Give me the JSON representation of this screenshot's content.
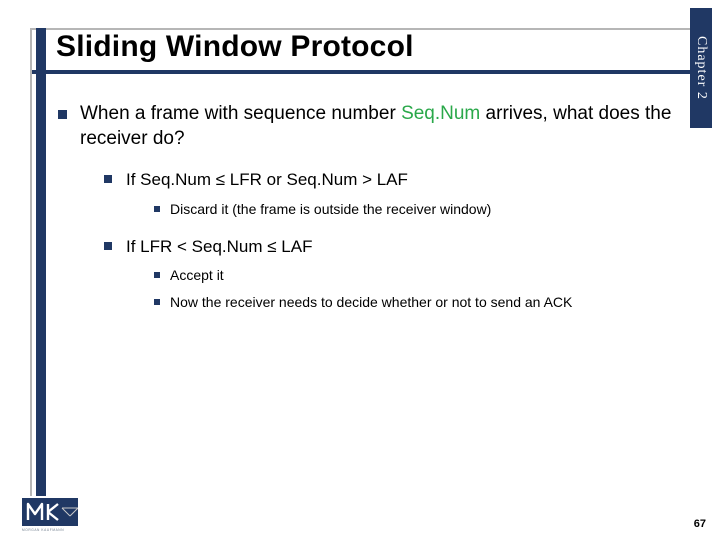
{
  "chapter_label": "Chapter 2",
  "title": "Sliding Window Protocol",
  "body": {
    "lead_pre": "When a frame with sequence number ",
    "seqnum": "Seq.Num",
    "lead_post": " arrives, what does the receiver do?",
    "cond1": "If Seq.Num ≤ LFR or Seq.Num > LAF",
    "cond1_sub": "Discard it (the frame is outside the receiver window)",
    "cond2": "If LFR < Seq.Num ≤ LAF",
    "cond2_sub1": "Accept it",
    "cond2_sub2": "Now the receiver needs to decide whether or not to send an ACK"
  },
  "page_number": "67",
  "logo_subtext": "MORGAN KAUFMANN"
}
